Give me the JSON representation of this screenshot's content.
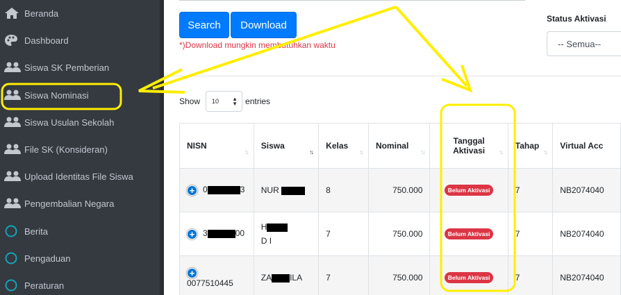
{
  "sidebar": {
    "items": [
      {
        "label": "Beranda",
        "icon": "home-icon"
      },
      {
        "label": "Dashboard",
        "icon": "palette-icon"
      },
      {
        "label": "Siswa SK Pemberian",
        "icon": "users-icon"
      },
      {
        "label": "Siswa Nominasi",
        "icon": "users-icon"
      },
      {
        "label": "Siswa Usulan Sekolah",
        "icon": "users-icon"
      },
      {
        "label": "File SK (Konsideran)",
        "icon": "users-icon"
      },
      {
        "label": "Upload Identitas File Siswa",
        "icon": "users-icon"
      },
      {
        "label": "Pengembalian Negara",
        "icon": "users-icon"
      },
      {
        "label": "Berita",
        "icon": "circle-icon"
      },
      {
        "label": "Pengaduan",
        "icon": "circle-icon"
      },
      {
        "label": "Peraturan",
        "icon": "circle-icon"
      }
    ]
  },
  "toolbar": {
    "search_label": "Search",
    "download_label": "Download",
    "note": "*)Download mungkin membutuhkan waktu"
  },
  "filter": {
    "status_label": "Status Aktivasi",
    "status_value": "-- Semua--"
  },
  "table_controls": {
    "show_label": "Show",
    "entries_value": "10",
    "entries_label": "entries"
  },
  "table": {
    "headers": [
      "NISN",
      "Siswa",
      "Kelas",
      "Nominal",
      "Tanggal Aktivasi",
      "Tahap",
      "Virtual Acc"
    ],
    "rows": [
      {
        "nisn_start": "0",
        "nisn_end": "3",
        "siswa_start": "NUR ",
        "siswa_end": "",
        "kelas": "8",
        "nominal": "750.000",
        "status": "Belum Aktivasi",
        "tahap": "7",
        "va": "NB2074040"
      },
      {
        "nisn_start": "3",
        "nisn_end": "00",
        "siswa_start": "H",
        "siswa_end": "D           I",
        "kelas": "7",
        "nominal": "750.000",
        "status": "Belum Aktivasi",
        "tahap": "7",
        "va": "NB2074040"
      },
      {
        "nisn_start": "0077510445",
        "nisn_end": "",
        "siswa_start": "ZA",
        "siswa_end": "ILA",
        "kelas": "7",
        "nominal": "750.000",
        "status": "Belum Aktivasi",
        "tahap": "7",
        "va": "NB2074040"
      }
    ]
  },
  "colors": {
    "sidebar_bg": "#343a40",
    "primary": "#007bff",
    "danger": "#dc3545",
    "annotation": "#ffee00"
  }
}
